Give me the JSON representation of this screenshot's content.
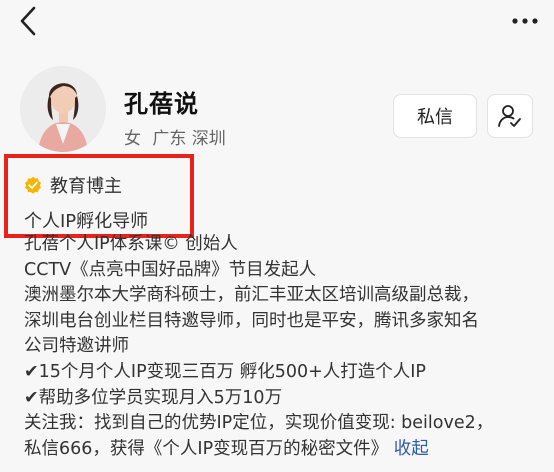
{
  "profile": {
    "name": "孔蓓说",
    "gender": "女",
    "location": "广东 深圳",
    "message_label": "私信",
    "verification": "教育博主",
    "tagline": "个人IP孵化导师"
  },
  "bio": {
    "lines": [
      "孔蓓个人IP体系课© 创始人",
      "CCTV《点亮中国好品牌》节目发起人",
      "澳洲墨尔本大学商科硕士，前汇丰亚太区培训高级副总裁，",
      "深圳电台创业栏目特邀导师，同时也是平安，腾讯多家知名",
      "公司特邀讲师",
      "✔15个月个人IP变现三百万 孵化500+人打造个人IP",
      "✔帮助多位学员实现月入5万10万",
      "关注我：找到自己的优势IP定位，实现价值变现: beilove2，"
    ],
    "last_line": "私信666，获得《个人IP变现百万的秘密文件》",
    "collapse_label": "收起"
  },
  "colors": {
    "highlight_border": "#e8231c",
    "verify_badge": "#f4b400",
    "link": "#2f5aa7"
  },
  "icons": [
    "back-icon",
    "more-icon",
    "follow-user-icon",
    "verified-badge-icon"
  ]
}
